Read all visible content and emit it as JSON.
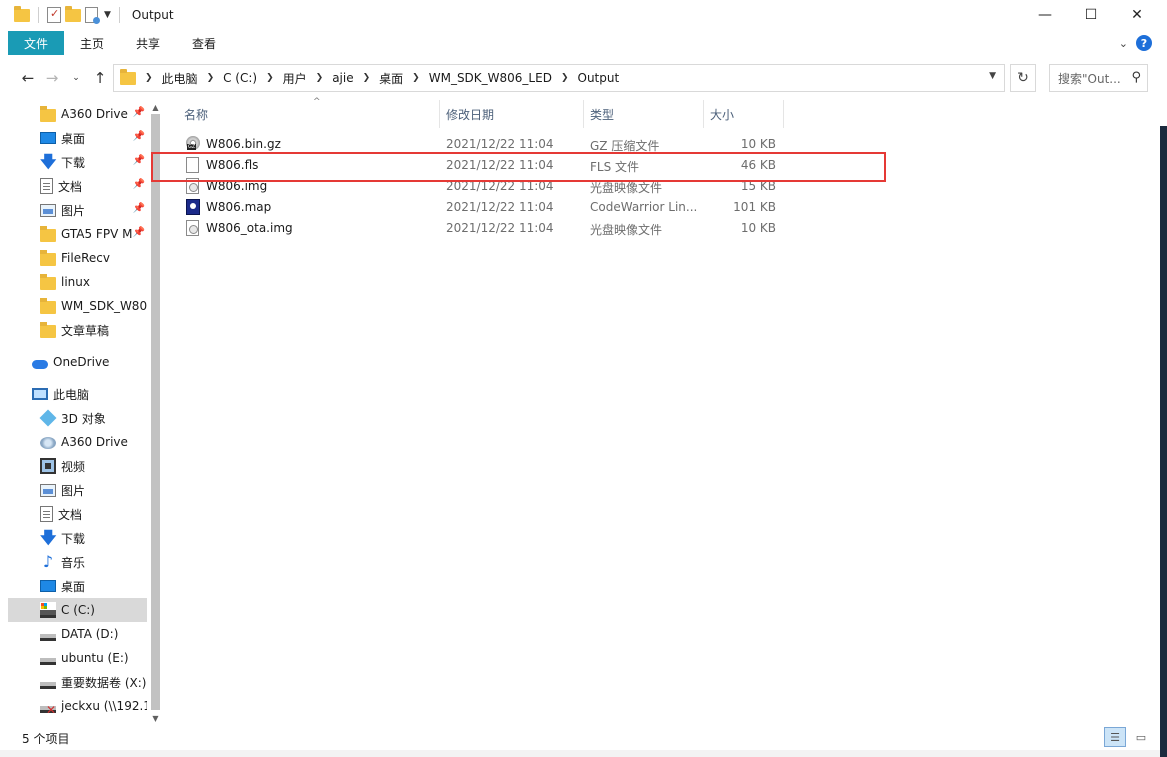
{
  "window": {
    "title": "Output",
    "controls": {
      "minimize": "—",
      "maximize": "☐",
      "close": "✕"
    }
  },
  "ribbon": {
    "file_tab": "文件",
    "tabs": [
      "主页",
      "共享",
      "查看"
    ],
    "help": "?"
  },
  "address": {
    "crumbs": [
      "此电脑",
      "C (C:)",
      "用户",
      "ajie",
      "桌面",
      "WM_SDK_W806_LED",
      "Output"
    ],
    "search_placeholder": "搜索\"Out..."
  },
  "sidebar": {
    "items": [
      {
        "label": "A360 Drive",
        "icon": "folder-icon",
        "pinned": true
      },
      {
        "label": "桌面",
        "icon": "desktop-icon",
        "pinned": true
      },
      {
        "label": "下载",
        "icon": "download-icon",
        "pinned": true
      },
      {
        "label": "文档",
        "icon": "document-icon",
        "pinned": true
      },
      {
        "label": "图片",
        "icon": "picture-icon",
        "pinned": true
      },
      {
        "label": "GTA5 FPV M",
        "icon": "folder-icon",
        "pinned": true
      },
      {
        "label": "FileRecv",
        "icon": "folder-icon",
        "pinned": false
      },
      {
        "label": "linux",
        "icon": "folder-icon",
        "pinned": false
      },
      {
        "label": "WM_SDK_W80",
        "icon": "folder-icon",
        "pinned": false
      },
      {
        "label": "文章草稿",
        "icon": "folder-icon",
        "pinned": false
      },
      {
        "label": "OneDrive",
        "icon": "cloud-icon",
        "pinned": false
      },
      {
        "label": "此电脑",
        "icon": "computer-icon",
        "pinned": false
      },
      {
        "label": "3D 对象",
        "icon": "cube-icon",
        "pinned": false
      },
      {
        "label": "A360 Drive",
        "icon": "a360-icon",
        "pinned": false
      },
      {
        "label": "视频",
        "icon": "video-icon",
        "pinned": false
      },
      {
        "label": "图片",
        "icon": "picture-icon",
        "pinned": false
      },
      {
        "label": "文档",
        "icon": "document-icon",
        "pinned": false
      },
      {
        "label": "下载",
        "icon": "download-icon",
        "pinned": false
      },
      {
        "label": "音乐",
        "icon": "music-icon",
        "pinned": false
      },
      {
        "label": "桌面",
        "icon": "desktop-icon",
        "pinned": false
      },
      {
        "label": "C (C:)",
        "icon": "drive-c-icon",
        "pinned": false,
        "selected": true
      },
      {
        "label": "DATA (D:)",
        "icon": "drive-icon",
        "pinned": false
      },
      {
        "label": "ubuntu (E:)",
        "icon": "drive-icon",
        "pinned": false
      },
      {
        "label": "重要数据卷 (X:)",
        "icon": "drive-icon",
        "pinned": false
      },
      {
        "label": "jeckxu (\\\\192.1",
        "icon": "network-drive-icon",
        "pinned": false
      }
    ]
  },
  "columns": {
    "name": "名称",
    "date": "修改日期",
    "type": "类型",
    "size": "大小"
  },
  "files": [
    {
      "name": "W806.bin.gz",
      "date": "2021/12/22 11:04",
      "type": "GZ 压缩文件",
      "size": "10 KB",
      "icon": "gz"
    },
    {
      "name": "W806.fls",
      "date": "2021/12/22 11:04",
      "type": "FLS 文件",
      "size": "46 KB",
      "icon": "blank"
    },
    {
      "name": "W806.img",
      "date": "2021/12/22 11:04",
      "type": "光盘映像文件",
      "size": "15 KB",
      "icon": "img"
    },
    {
      "name": "W806.map",
      "date": "2021/12/22 11:04",
      "type": "CodeWarrior Lin...",
      "size": "101 KB",
      "icon": "map"
    },
    {
      "name": "W806_ota.img",
      "date": "2021/12/22 11:04",
      "type": "光盘映像文件",
      "size": "10 KB",
      "icon": "img"
    }
  ],
  "status": {
    "count": "5 个项目"
  },
  "colors": {
    "file_tab": "#1a9bb5",
    "highlight": "#e53935",
    "selected": "#d9d9d9"
  }
}
